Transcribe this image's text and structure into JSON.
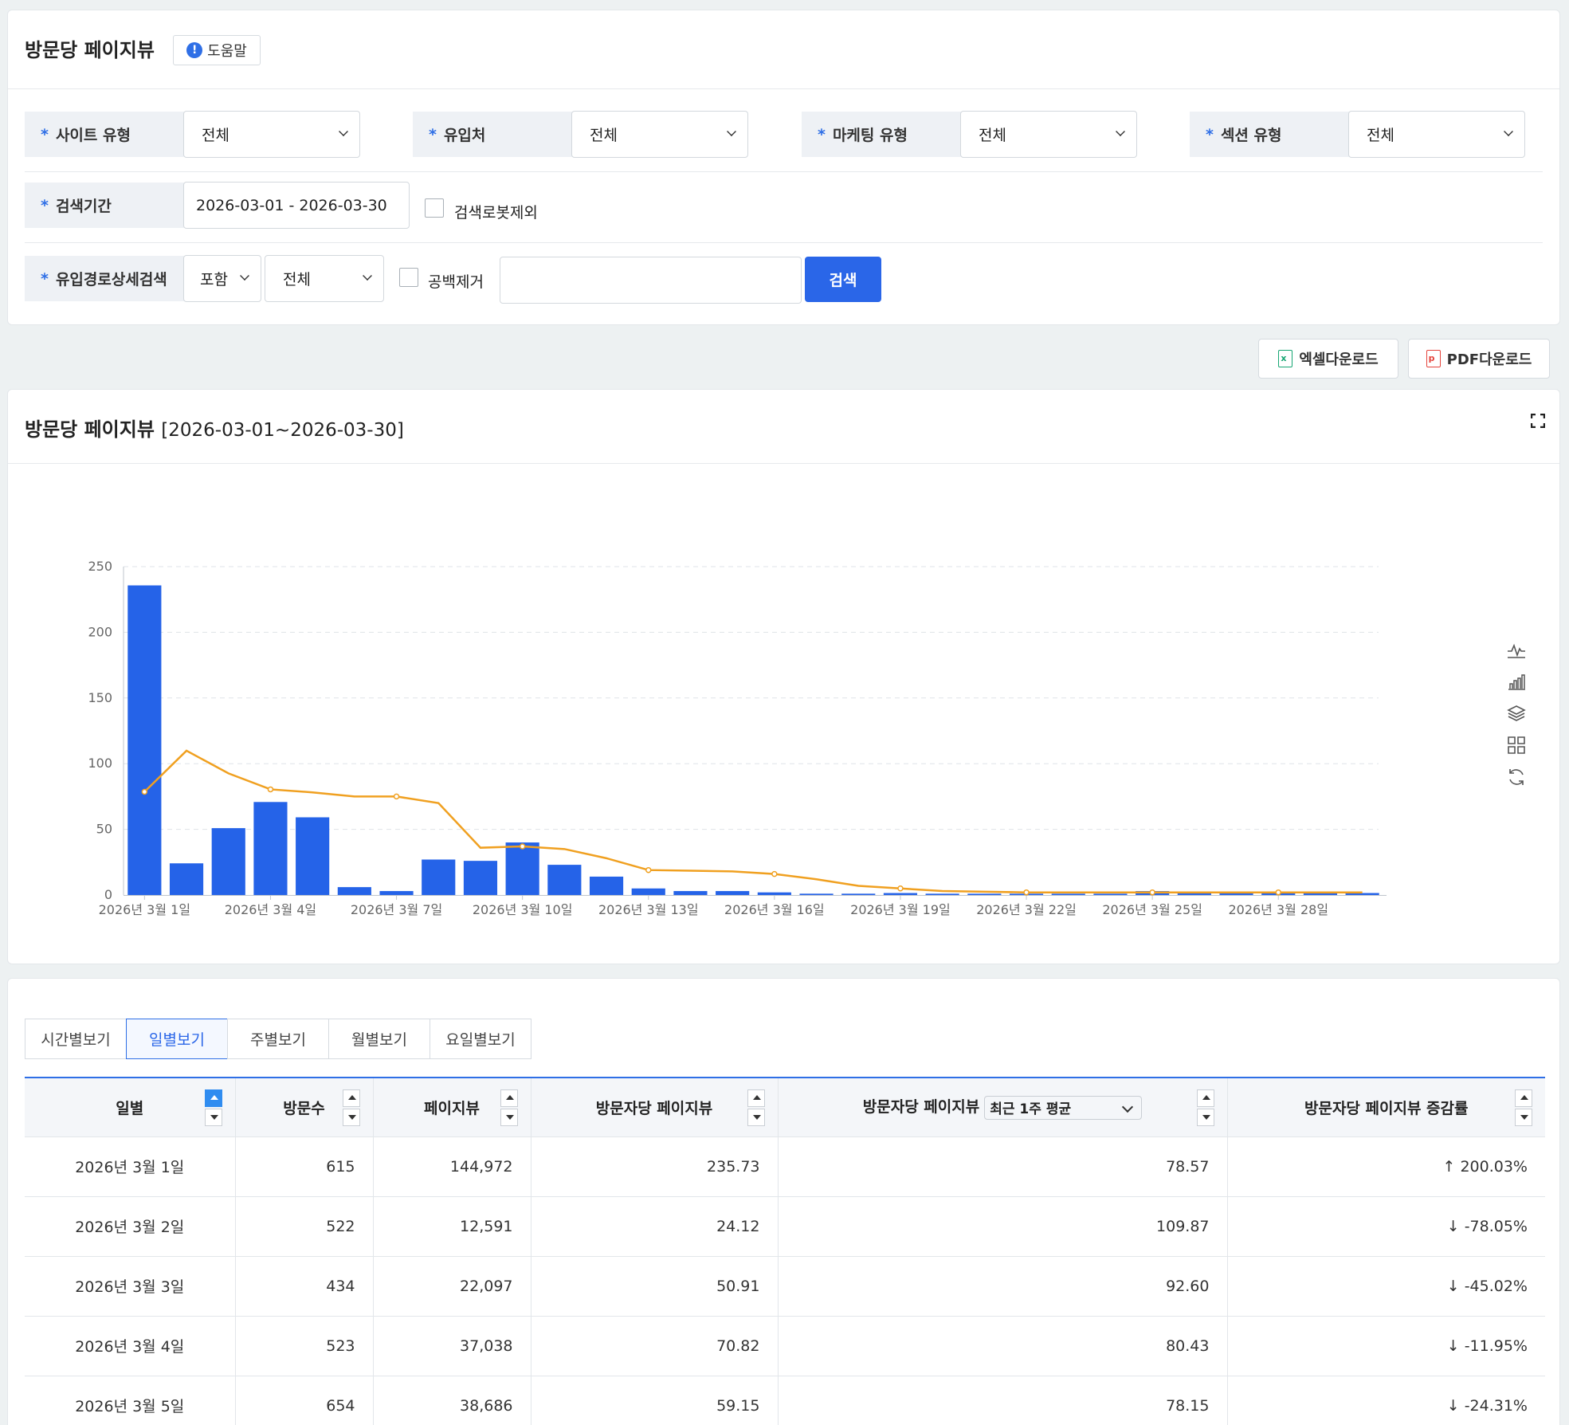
{
  "filter_panel": {
    "title": "방문당 페이지뷰",
    "help_label": "도움말",
    "help_icon": "info-icon",
    "fields": {
      "site_type": {
        "label": "사이트 유형",
        "value": "전체"
      },
      "referrer": {
        "label": "유입처",
        "value": "전체"
      },
      "marketing_type": {
        "label": "마케팅 유형",
        "value": "전체"
      },
      "section_type": {
        "label": "섹션 유형",
        "value": "전체"
      },
      "period": {
        "label": "검색기간",
        "value": "2026-03-01 - 2026-03-30"
      },
      "exclude_bots": {
        "label": "검색로봇제외",
        "checked": false
      },
      "path_detail": {
        "label": "유입경로상세검색",
        "include_value": "포함",
        "scope_value": "전체"
      },
      "trim_spaces": {
        "label": "공백제거",
        "checked": false
      },
      "search_text": {
        "value": ""
      }
    },
    "required_mark": "*",
    "search_label": "검색"
  },
  "downloads": {
    "excel_label": "엑셀다운로드",
    "pdf_label": "PDF다운로드",
    "excel_color": "#17a673",
    "pdf_color": "#e5433b"
  },
  "chart_panel": {
    "title": "방문당 페이지뷰",
    "range": "[2026-03-01~2026-03-30]",
    "toolbox_icons": [
      "line-chart-icon",
      "bar-chart-icon",
      "stack-icon",
      "tiled-icon",
      "restore-icon"
    ]
  },
  "chart_data": {
    "type": "bar",
    "ylim": [
      0,
      250
    ],
    "yticks": [
      "0",
      "50",
      "100",
      "150",
      "200",
      "250"
    ],
    "categories": [
      "2026년 3월 1일",
      "2026년 3월 2일",
      "2026년 3월 3일",
      "2026년 3월 4일",
      "2026년 3월 5일",
      "2026년 3월 6일",
      "2026년 3월 7일",
      "2026년 3월 8일",
      "2026년 3월 9일",
      "2026년 3월 10일",
      "2026년 3월 11일",
      "2026년 3월 12일",
      "2026년 3월 13일",
      "2026년 3월 14일",
      "2026년 3월 15일",
      "2026년 3월 16일",
      "2026년 3월 17일",
      "2026년 3월 18일",
      "2026년 3월 19일",
      "2026년 3월 20일",
      "2026년 3월 21일",
      "2026년 3월 22일",
      "2026년 3월 23일",
      "2026년 3월 24일",
      "2026년 3월 25일",
      "2026년 3월 26일",
      "2026년 3월 27일",
      "2026년 3월 28일",
      "2026년 3월 29일",
      "2026년 3월 30일"
    ],
    "xtick_labels": [
      "2026년 3월 1일",
      "2026년 3월 4일",
      "2026년 3월 7일",
      "2026년 3월 10일",
      "2026년 3월 13일",
      "2026년 3월 16일",
      "2026년 3월 19일",
      "2026년 3월 22일",
      "2026년 3월 25일",
      "2026년 3월 28일"
    ],
    "xtick_indices": [
      0,
      3,
      6,
      9,
      12,
      15,
      18,
      21,
      24,
      27
    ],
    "series": [
      {
        "kind": "bar",
        "color": "#2563e8",
        "values": [
          235.73,
          24.12,
          50.91,
          70.82,
          59.15,
          6,
          3,
          27,
          26,
          40,
          23,
          14,
          5,
          3,
          3,
          2,
          1,
          1,
          1.5,
          1,
          1,
          1,
          1,
          1,
          3,
          2,
          1.5,
          1.5,
          1.5,
          1.5
        ]
      },
      {
        "kind": "line",
        "color": "#f0a020",
        "values": [
          78.57,
          109.87,
          92.6,
          80.43,
          78.15,
          75,
          75,
          70,
          36,
          37,
          35,
          28,
          19,
          18.5,
          18,
          16,
          12,
          7,
          5,
          3,
          2.5,
          2,
          2,
          2,
          2,
          2,
          2,
          2,
          2,
          2
        ]
      }
    ]
  },
  "table": {
    "tabs": [
      "시간별보기",
      "일별보기",
      "주별보기",
      "월별보기",
      "요일별보기"
    ],
    "active_tab": 1,
    "columns": [
      "일별",
      "방문수",
      "페이지뷰",
      "방문자당 페이지뷰",
      "방문자당 페이지뷰",
      "방문자당 페이지뷰 증감률"
    ],
    "avg_select_value": "최근 1주 평균",
    "rows": [
      {
        "date": "2026년 3월 1일",
        "visits": "615",
        "pageviews": "144,972",
        "pv_per_visitor": "235.73",
        "avg": "78.57",
        "change": "200.03%",
        "dir": "up"
      },
      {
        "date": "2026년 3월 2일",
        "visits": "522",
        "pageviews": "12,591",
        "pv_per_visitor": "24.12",
        "avg": "109.87",
        "change": "-78.05%",
        "dir": "down"
      },
      {
        "date": "2026년 3월 3일",
        "visits": "434",
        "pageviews": "22,097",
        "pv_per_visitor": "50.91",
        "avg": "92.60",
        "change": "-45.02%",
        "dir": "down"
      },
      {
        "date": "2026년 3월 4일",
        "visits": "523",
        "pageviews": "37,038",
        "pv_per_visitor": "70.82",
        "avg": "80.43",
        "change": "-11.95%",
        "dir": "down"
      },
      {
        "date": "2026년 3월 5일",
        "visits": "654",
        "pageviews": "38,686",
        "pv_per_visitor": "59.15",
        "avg": "78.15",
        "change": "-24.31%",
        "dir": "down"
      }
    ]
  }
}
